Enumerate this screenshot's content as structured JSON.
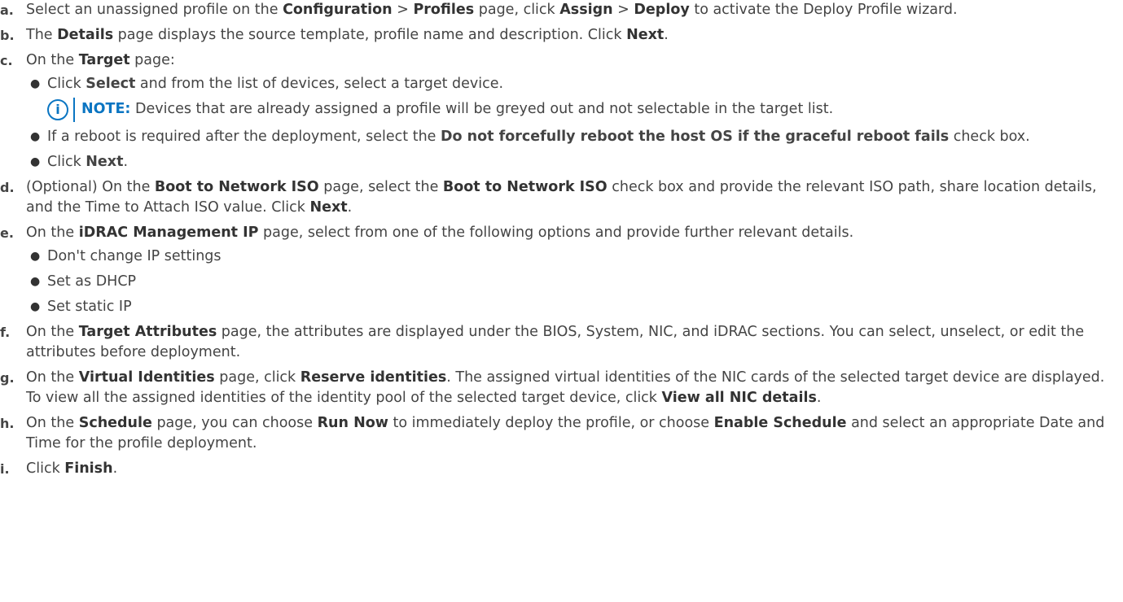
{
  "steps": [
    {
      "letter": "a.",
      "parts": [
        "Select an unassigned profile on the ",
        "Configuration",
        " > ",
        "Profiles",
        " page, click ",
        "Assign",
        " > ",
        "Deploy",
        " to activate the Deploy Profile wizard."
      ]
    },
    {
      "letter": "b.",
      "parts": [
        "The ",
        "Details",
        " page displays the source template, profile name and description. Click ",
        "Next",
        "."
      ]
    },
    {
      "letter": "c.",
      "parts": [
        "On the ",
        "Target",
        " page:"
      ],
      "bullets": [
        {
          "parts": [
            "Click ",
            "Select",
            " and from the list of devices, select a target device."
          ]
        },
        {
          "parts": [
            "If a reboot is required after the deployment, select the ",
            "Do not forcefully reboot the host OS if the graceful reboot fails",
            " check box."
          ]
        },
        {
          "parts": [
            "Click ",
            "Next",
            "."
          ]
        }
      ],
      "note": {
        "label": "NOTE:",
        "text": " Devices that are already assigned a profile will be greyed out and not selectable in the target list."
      }
    },
    {
      "letter": "d.",
      "parts": [
        "(Optional) On the ",
        "Boot to Network ISO",
        " page, select the ",
        "Boot to Network ISO",
        " check box and provide the relevant ISO path, share location details, and the Time to Attach ISO value. Click ",
        "Next",
        "."
      ]
    },
    {
      "letter": "e.",
      "parts": [
        "On the ",
        "iDRAC Management IP",
        " page, select from one of the following options and provide further relevant details."
      ],
      "bullets": [
        {
          "parts": [
            "Don't change IP settings"
          ]
        },
        {
          "parts": [
            "Set as DHCP"
          ]
        },
        {
          "parts": [
            "Set static IP"
          ]
        }
      ]
    },
    {
      "letter": "f.",
      "parts": [
        "On the ",
        "Target Attributes",
        " page, the attributes are displayed under the BIOS, System, NIC, and iDRAC sections. You can select, unselect, or edit the attributes before deployment."
      ]
    },
    {
      "letter": "g.",
      "parts": [
        "On the ",
        "Virtual Identities",
        " page, click ",
        "Reserve identities",
        ". The assigned virtual identities of the NIC cards of the selected target device are displayed. To view all the assigned identities of the identity pool of the selected target device, click ",
        "View all NIC details",
        "."
      ]
    },
    {
      "letter": "h.",
      "parts": [
        "On the ",
        "Schedule",
        " page, you can choose ",
        "Run Now",
        " to immediately deploy the profile, or choose ",
        "Enable Schedule",
        " and select an appropriate Date and Time for the profile deployment."
      ]
    },
    {
      "letter": "i.",
      "parts": [
        "Click ",
        "Finish",
        "."
      ]
    }
  ]
}
